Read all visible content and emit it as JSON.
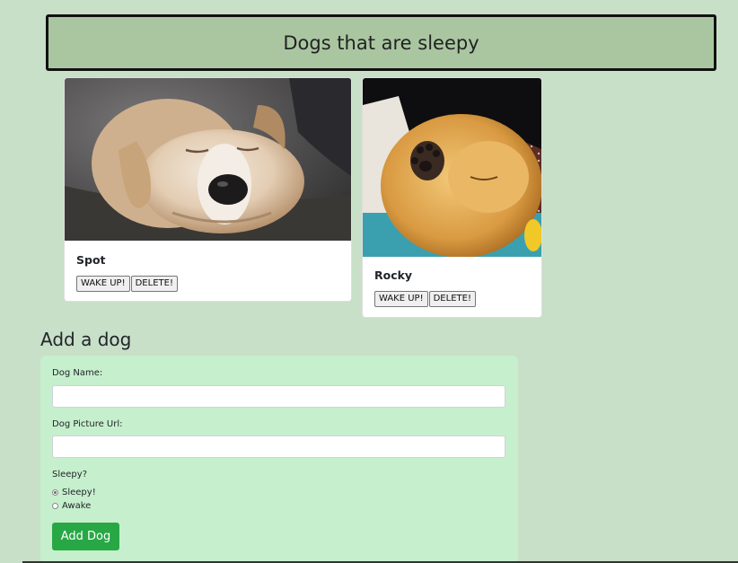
{
  "header": {
    "title": "Dogs that are sleepy"
  },
  "dogs": [
    {
      "name": "Spot",
      "wake_label": "WAKE UP!",
      "delete_label": "DELETE!",
      "image": "sleeping-puppy-on-couch"
    },
    {
      "name": "Rocky",
      "wake_label": "WAKE UP!",
      "delete_label": "DELETE!",
      "image": "sleeping-fluffy-puppy-with-paw"
    }
  ],
  "add_section": {
    "title": "Add a dog",
    "name_label": "Dog Name:",
    "name_value": "",
    "url_label": "Dog Picture Url:",
    "url_value": "",
    "sleepy_label": "Sleepy?",
    "options": [
      {
        "label": "Sleepy!",
        "selected": true
      },
      {
        "label": "Awake",
        "selected": false
      }
    ],
    "submit_label": "Add Dog"
  },
  "colors": {
    "page_background": "#c8dfc8",
    "header_background": "#a9c6a1",
    "form_background": "#c6efcd",
    "submit_button": "#28a745"
  }
}
